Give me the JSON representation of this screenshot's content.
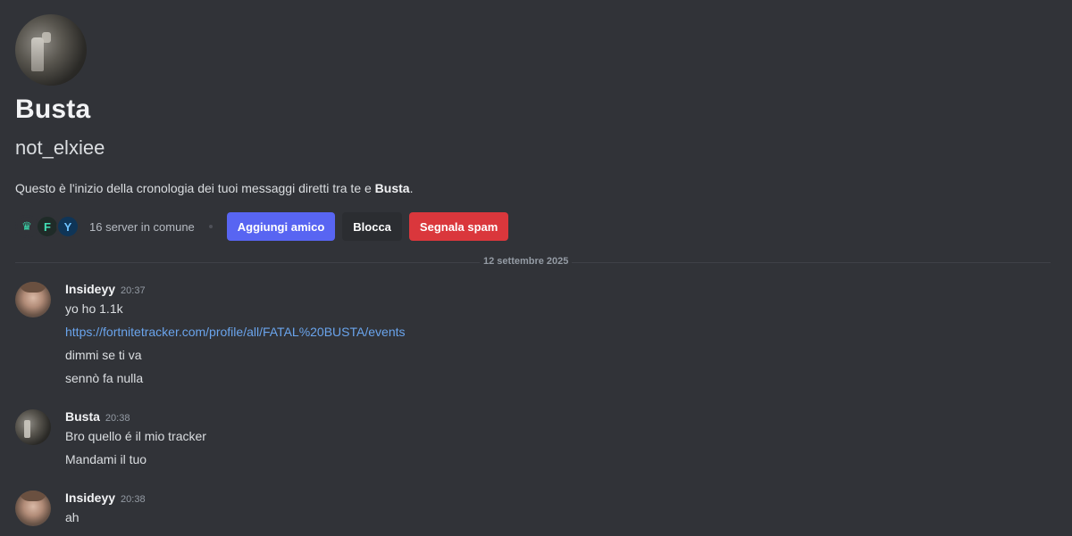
{
  "profile": {
    "display_name": "Busta",
    "username": "not_elxiee",
    "intro_prefix": "Questo è l'inizio della cronologia dei tuoi messaggi diretti tra te e ",
    "intro_name": "Busta",
    "intro_suffix": ".",
    "mutual_servers": "16 server in comune",
    "server_icons": [
      "crown-icon",
      "letter-f-icon",
      "letter-y-icon"
    ],
    "buttons": {
      "add_friend": "Aggiungi amico",
      "block": "Blocca",
      "report_spam": "Segnala spam"
    }
  },
  "divider": {
    "date": "12 settembre 2025"
  },
  "messages": [
    {
      "author": "Insideyy",
      "time": "20:37",
      "lines": [
        {
          "text": "yo ho 1.1k"
        },
        {
          "text": "https://fortnitetracker.com/profile/all/FATAL%20BUSTA/events",
          "link": true
        },
        {
          "text": "dimmi se ti va"
        },
        {
          "text": "sennò fa nulla"
        }
      ]
    },
    {
      "author": "Busta",
      "time": "20:38",
      "lines": [
        {
          "text": "Bro quello é il mio tracker"
        },
        {
          "text": "Mandami il tuo"
        }
      ]
    },
    {
      "author": "Insideyy",
      "time": "20:38",
      "lines": [
        {
          "text": "ah"
        }
      ]
    }
  ],
  "colors": {
    "background": "#313338",
    "primary_button": "#5865f2",
    "danger_button": "#da373c",
    "link": "#6aa4ec"
  }
}
